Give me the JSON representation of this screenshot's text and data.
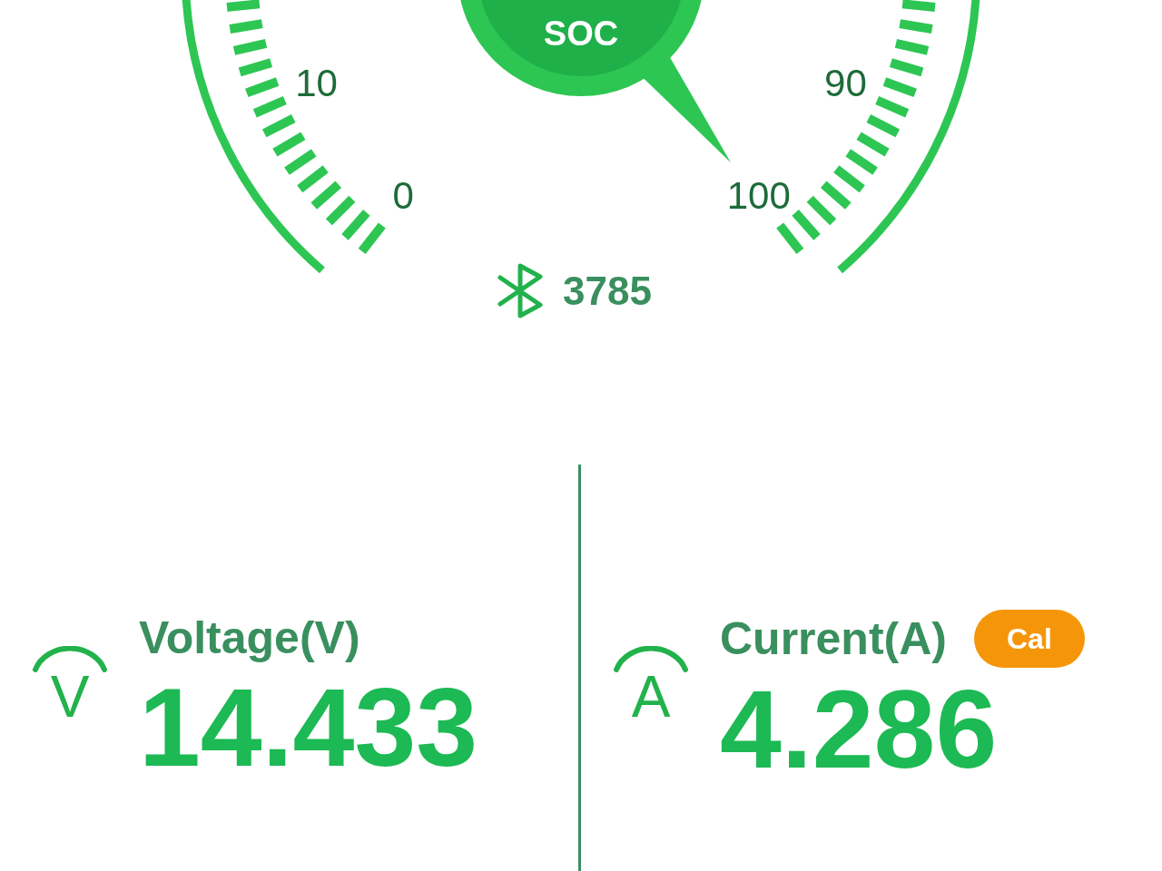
{
  "gauge": {
    "label": "SOC",
    "scale_labels": [
      "0",
      "10",
      "90",
      "100"
    ]
  },
  "bluetooth": {
    "id": "3785"
  },
  "readings": [
    {
      "symbol": "V",
      "label": "Voltage(V)",
      "value": "14.433"
    },
    {
      "symbol": "A",
      "label": "Current(A)",
      "value": "4.286",
      "button": "Cal"
    }
  ]
}
